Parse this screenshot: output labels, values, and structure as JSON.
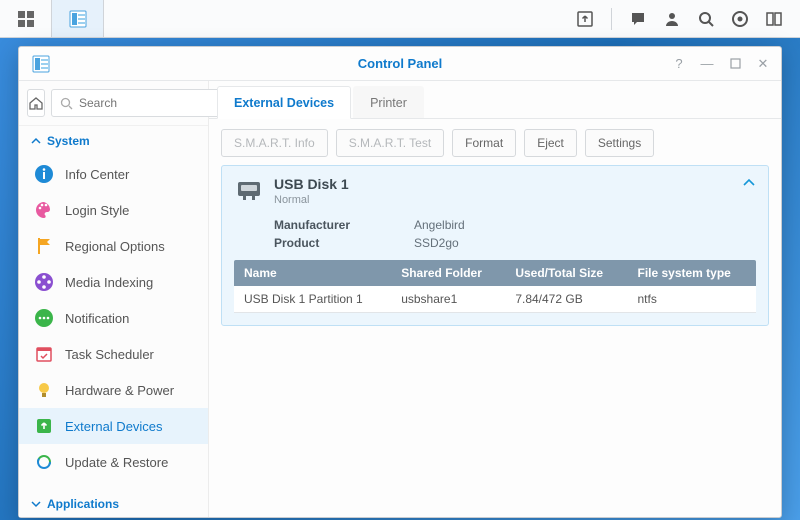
{
  "window": {
    "title": "Control Panel"
  },
  "search": {
    "placeholder": "Search"
  },
  "sidebar": {
    "category_system": "System",
    "category_applications": "Applications",
    "items": [
      {
        "label": "Info Center"
      },
      {
        "label": "Login Style"
      },
      {
        "label": "Regional Options"
      },
      {
        "label": "Media Indexing"
      },
      {
        "label": "Notification"
      },
      {
        "label": "Task Scheduler"
      },
      {
        "label": "Hardware & Power"
      },
      {
        "label": "External Devices"
      },
      {
        "label": "Update & Restore"
      }
    ]
  },
  "tabs": {
    "external_devices": "External Devices",
    "printer": "Printer"
  },
  "toolbar": {
    "smart_info": "S.M.A.R.T. Info",
    "smart_test": "S.M.A.R.T. Test",
    "format": "Format",
    "eject": "Eject",
    "settings": "Settings"
  },
  "disk": {
    "title": "USB Disk 1",
    "status": "Normal",
    "meta": {
      "manufacturer_k": "Manufacturer",
      "manufacturer_v": "Angelbird",
      "product_k": "Product",
      "product_v": "SSD2go"
    },
    "columns": {
      "name": "Name",
      "shared": "Shared Folder",
      "size": "Used/Total Size",
      "fs": "File system type"
    },
    "partition": {
      "name": "USB Disk 1 Partition 1",
      "shared": "usbshare1",
      "size": "7.84/472 GB",
      "fs": "ntfs"
    }
  }
}
